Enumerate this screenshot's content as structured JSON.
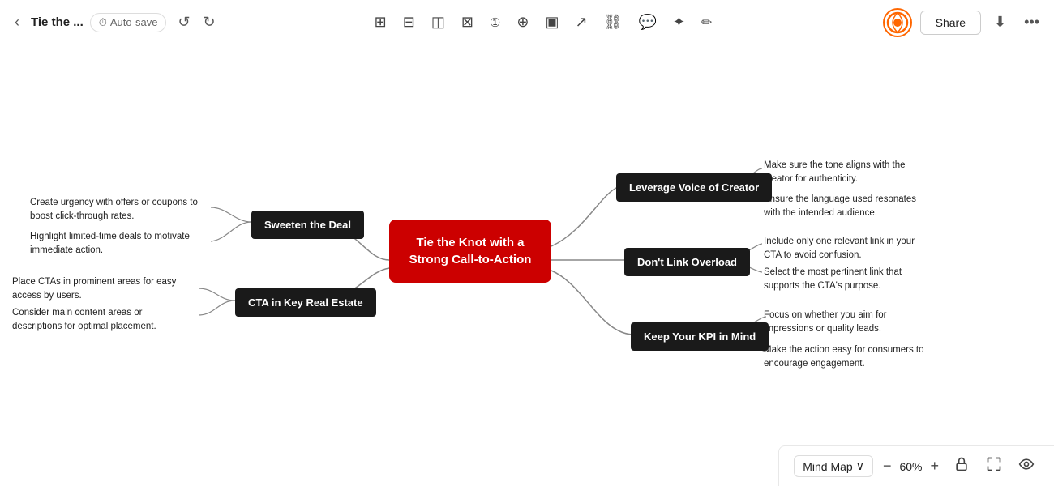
{
  "header": {
    "back_label": "‹",
    "title": "Tie the ...",
    "autosave_label": "Auto-save",
    "undo_label": "↺",
    "redo_label": "↻",
    "share_label": "Share",
    "download_label": "⬇",
    "more_label": "•••"
  },
  "toolbar": {
    "tools": [
      "⬜",
      "⬜",
      "⬛",
      "⬛",
      "①",
      "+",
      "⬚",
      "↗",
      "🔗",
      "📋",
      "✦",
      "↗"
    ]
  },
  "mindmap": {
    "central_node": "Tie the Knot with a Strong Call-to-Action",
    "nodes": [
      {
        "id": "sweeten",
        "label": "Sweeten the Deal",
        "side": "left"
      },
      {
        "id": "cta",
        "label": "CTA in Key Real Estate",
        "side": "left"
      },
      {
        "id": "leverage",
        "label": "Leverage Voice of Creator",
        "side": "right"
      },
      {
        "id": "link",
        "label": "Don't Link Overload",
        "side": "right"
      },
      {
        "id": "kpi",
        "label": "Keep Your KPI in Mind",
        "side": "right"
      }
    ],
    "left_texts": [
      {
        "id": "t1",
        "text": "Create urgency with offers or coupons to boost click-through rates."
      },
      {
        "id": "t2",
        "text": "Highlight limited-time deals to motivate immediate action."
      },
      {
        "id": "t3",
        "text": "Place CTAs in prominent areas for easy access by users."
      },
      {
        "id": "t4",
        "text": "Consider main content areas or descriptions for optimal placement."
      }
    ],
    "right_texts": [
      {
        "id": "r1",
        "text": "Make sure the tone aligns with the creator for authenticity."
      },
      {
        "id": "r2",
        "text": "Ensure the language used resonates with the intended audience."
      },
      {
        "id": "r3",
        "text": "Include only one relevant link in your CTA to avoid confusion."
      },
      {
        "id": "r4",
        "text": "Select the most pertinent link that supports the CTA's purpose."
      },
      {
        "id": "r5",
        "text": "Focus on whether you aim for impressions or quality leads."
      },
      {
        "id": "r6",
        "text": "Make the action easy for consumers to encourage engagement."
      }
    ]
  },
  "bottombar": {
    "view_label": "Mind Map",
    "chevron": "∨",
    "zoom_minus": "−",
    "zoom_level": "60%",
    "zoom_plus": "+",
    "lock_icon": "🔒",
    "fullscreen_icon": "⛶",
    "eye_icon": "👁"
  }
}
